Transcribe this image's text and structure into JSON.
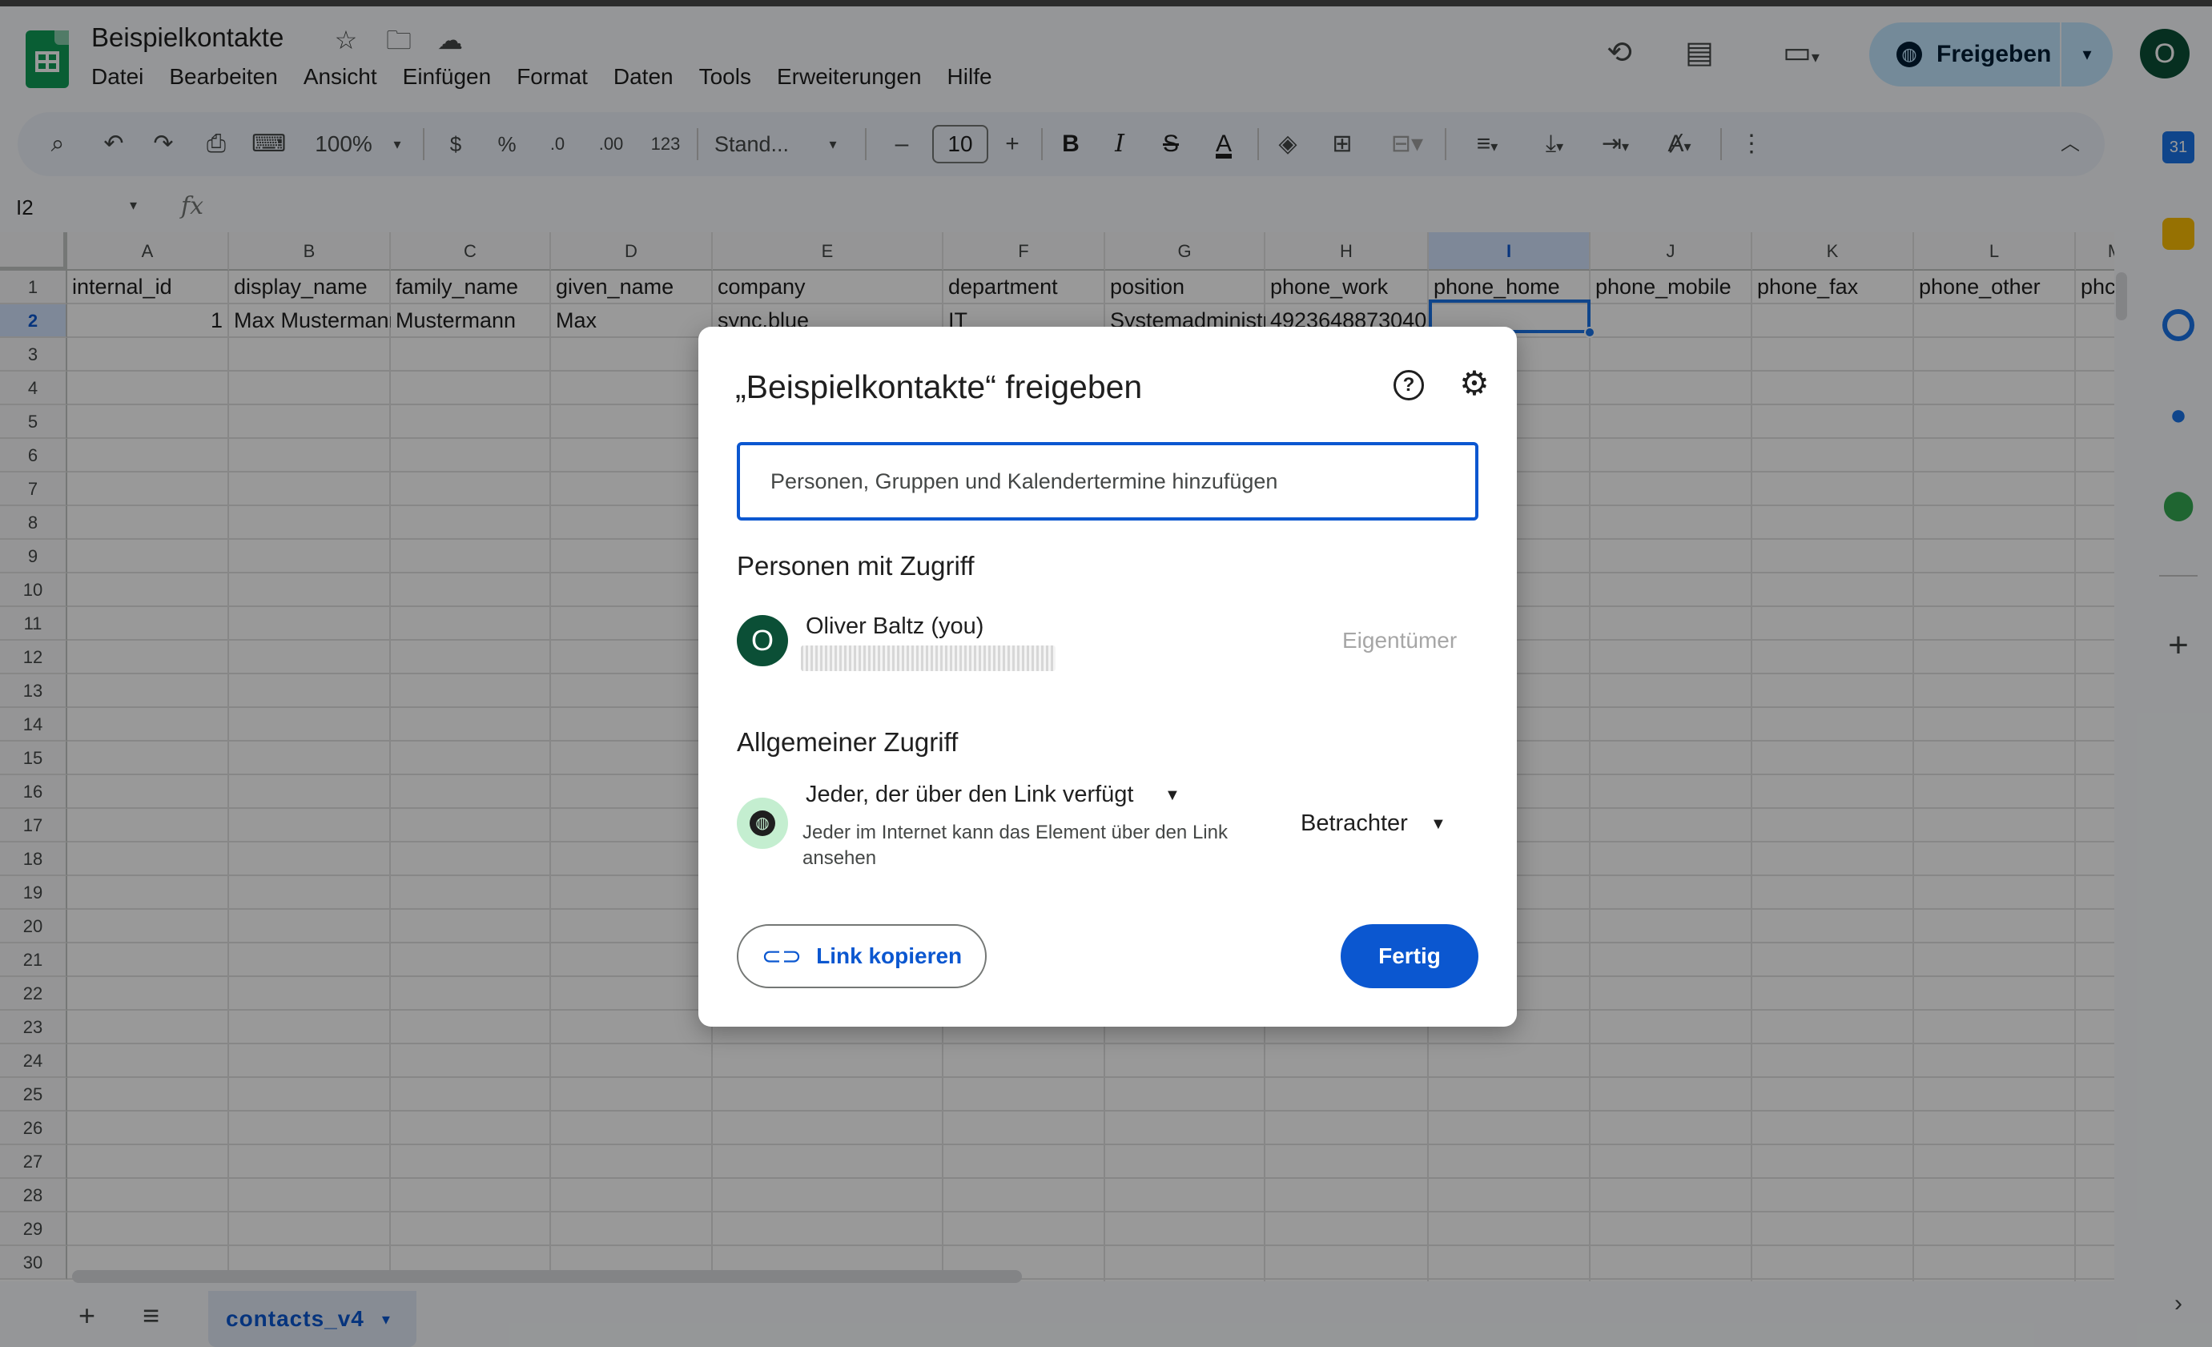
{
  "header": {
    "doc_title": "Beispielkontakte",
    "menu": [
      "Datei",
      "Bearbeiten",
      "Ansicht",
      "Einfügen",
      "Format",
      "Daten",
      "Tools",
      "Erweiterungen",
      "Hilfe"
    ],
    "share_label": "Freigeben",
    "avatar_letter": "O"
  },
  "toolbar": {
    "zoom": "100%",
    "currency": "$",
    "percent": "%",
    "dec_decrease": ".0",
    "dec_increase": ".00",
    "number_format": "123",
    "font": "Stand...",
    "font_size": "10",
    "minus": "–",
    "plus": "+",
    "bold": "B",
    "italic": "I",
    "strike": "S",
    "text_color": "A"
  },
  "formula_bar": {
    "cell_ref": "I2",
    "fx": "fx"
  },
  "sheet": {
    "columns": [
      "A",
      "B",
      "C",
      "D",
      "E",
      "F",
      "G",
      "H",
      "I",
      "J",
      "K",
      "L",
      "M"
    ],
    "selected_column": "I",
    "selected_row": "2",
    "rows": [
      "1",
      "2",
      "3",
      "4",
      "5",
      "6",
      "7",
      "8",
      "9",
      "10",
      "11",
      "12",
      "13",
      "14",
      "15",
      "16",
      "17",
      "18",
      "19",
      "20",
      "21",
      "22",
      "23",
      "24",
      "25",
      "26",
      "27",
      "28",
      "29",
      "30"
    ],
    "header_row": [
      "internal_id",
      "display_name",
      "family_name",
      "given_name",
      "company",
      "department",
      "position",
      "phone_work",
      "phone_home",
      "phone_mobile",
      "phone_fax",
      "phone_other",
      "phc"
    ],
    "data_row": [
      "1",
      "Max Mustermann",
      "Mustermann",
      "Max",
      "sync.blue",
      "IT",
      "Systemadministrator",
      "4923648873040",
      "",
      "",
      "",
      "",
      ""
    ]
  },
  "bottom": {
    "tab_name": "contacts_v4"
  },
  "dialog": {
    "title": "„Beispielkontakte“ freigeben",
    "input_placeholder": "Personen, Gruppen und Kalendertermine hinzufügen",
    "people_heading": "Personen mit Zugriff",
    "user_avatar": "O",
    "user_name": "Oliver Baltz (you)",
    "user_role": "Eigentümer",
    "general_heading": "Allgemeiner Zugriff",
    "access_option": "Jeder, der über den Link verfügt",
    "access_description": "Jeder im Internet kann das Element über den Link ansehen",
    "role_option": "Betrachter",
    "copy_link_label": "Link kopieren",
    "done_label": "Fertig"
  },
  "colors": {
    "accent": "#0b57d0",
    "share_bg": "#c2e7ff",
    "avatar": "#0b4f36",
    "sheets_green": "#0f9d58"
  }
}
